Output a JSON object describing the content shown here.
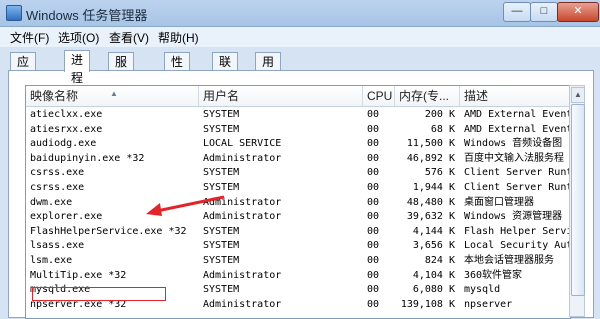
{
  "window": {
    "title": "Windows 任务管理器",
    "min": "—",
    "max": "□",
    "close": "✕"
  },
  "menu": [
    "文件(F)",
    "选项(O)",
    "查看(V)",
    "帮助(H)"
  ],
  "tabs": [
    "应用程序",
    "进程",
    "服务",
    "性能",
    "联网",
    "用户"
  ],
  "active_tab": "进程",
  "table": {
    "headers": [
      "映像名称",
      "用户名",
      "CPU",
      "内存(专...",
      "描述"
    ],
    "rows": [
      [
        "atieclxx.exe",
        "SYSTEM",
        "00",
        "200 K",
        "AMD External Events"
      ],
      [
        "atiesrxx.exe",
        "SYSTEM",
        "00",
        "68 K",
        "AMD External Events"
      ],
      [
        "audiodg.exe",
        "LOCAL SERVICE",
        "00",
        "11,500 K",
        "Windows 音频设备图"
      ],
      [
        "baidupinyin.exe *32",
        "Administrator",
        "00",
        "46,892 K",
        "百度中文输入法服务程"
      ],
      [
        "csrss.exe",
        "SYSTEM",
        "00",
        "576 K",
        "Client Server Runti"
      ],
      [
        "csrss.exe",
        "SYSTEM",
        "00",
        "1,944 K",
        "Client Server Runti"
      ],
      [
        "dwm.exe",
        "Administrator",
        "00",
        "48,480 K",
        "桌面窗口管理器"
      ],
      [
        "explorer.exe",
        "Administrator",
        "00",
        "39,632 K",
        "Windows 资源管理器"
      ],
      [
        "FlashHelperService.exe *32",
        "SYSTEM",
        "00",
        "4,144 K",
        "Flash Helper Service"
      ],
      [
        "lsass.exe",
        "SYSTEM",
        "00",
        "3,656 K",
        "Local Security Auth"
      ],
      [
        "lsm.exe",
        "SYSTEM",
        "00",
        "824 K",
        "本地会话管理器服务"
      ],
      [
        "MultiTip.exe *32",
        "Administrator",
        "00",
        "4,104 K",
        "360软件管家"
      ],
      [
        "mysqld.exe",
        "SYSTEM",
        "00",
        "6,080 K",
        "mysqld"
      ],
      [
        "npserver.exe *32",
        "Administrator",
        "00",
        "139,108 K",
        "npserver"
      ]
    ]
  },
  "annotation": {
    "highlighted_row": "explorer.exe",
    "color": "#e0252b"
  },
  "colors": {
    "titlebar": "#b3cdea",
    "background": "#d5e3f3"
  }
}
